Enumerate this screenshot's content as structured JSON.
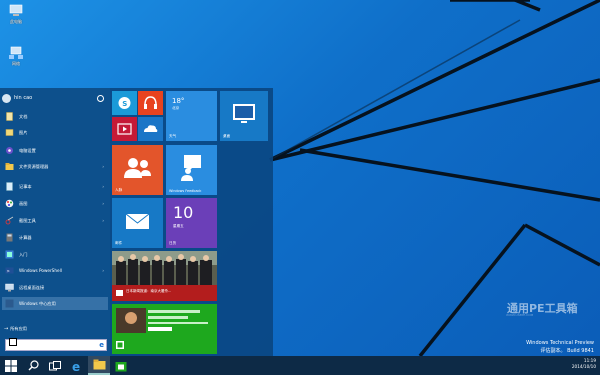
{
  "desktop": {
    "icons": [
      {
        "label": "此电脑",
        "icon": "computer-icon"
      },
      {
        "label": "网络",
        "icon": "network-icon"
      },
      {
        "label": "回收站",
        "icon": "recycle-bin-icon"
      }
    ],
    "watermark": "通用PE工具箱",
    "watermark_sub": "WWW.USEPE.COM",
    "preview_line1": "Windows Technical Preview",
    "preview_line2": "评估副本。 Build 9841"
  },
  "start_menu": {
    "user_name": "hin cao",
    "items": [
      {
        "label": "文档",
        "icon": "documents-icon",
        "chevron": false
      },
      {
        "label": "图片",
        "icon": "pictures-icon",
        "chevron": false
      },
      {
        "label": "电脑设置",
        "icon": "settings-icon",
        "chevron": false
      },
      {
        "label": "文件资源管理器",
        "icon": "file-explorer-icon",
        "chevron": true
      },
      {
        "label": "记事本",
        "icon": "notepad-icon",
        "chevron": true
      },
      {
        "label": "画图",
        "icon": "paint-icon",
        "chevron": true
      },
      {
        "label": "截图工具",
        "icon": "snipping-tool-icon",
        "chevron": true
      },
      {
        "label": "计算器",
        "icon": "calculator-icon",
        "chevron": false
      },
      {
        "label": "入门",
        "icon": "getting-started-icon",
        "chevron": false
      },
      {
        "label": "Windows PowerShell",
        "icon": "powershell-icon",
        "chevron": true
      },
      {
        "label": "远程桌面连接",
        "icon": "remote-desktop-icon",
        "chevron": false
      },
      {
        "label": "Windows 中心应用",
        "icon": "app-icon",
        "chevron": false
      }
    ],
    "all_apps": "所有应用",
    "tiles": {
      "weather_temp": "18°",
      "weather_city": "北京",
      "weather_label": "天气",
      "desktop_label": "桌面",
      "people_label": "人脉",
      "feedback_label": "Windows Feedback",
      "mail_label": "邮件",
      "calendar_day": "10",
      "calendar_weekday": "星期五",
      "calendar_label": "日历",
      "news_text": "日本新闻报道：南京大屠杀...",
      "store_text": "商店"
    }
  },
  "taskbar": {
    "time": "11:19",
    "date": "2014/10/10"
  }
}
